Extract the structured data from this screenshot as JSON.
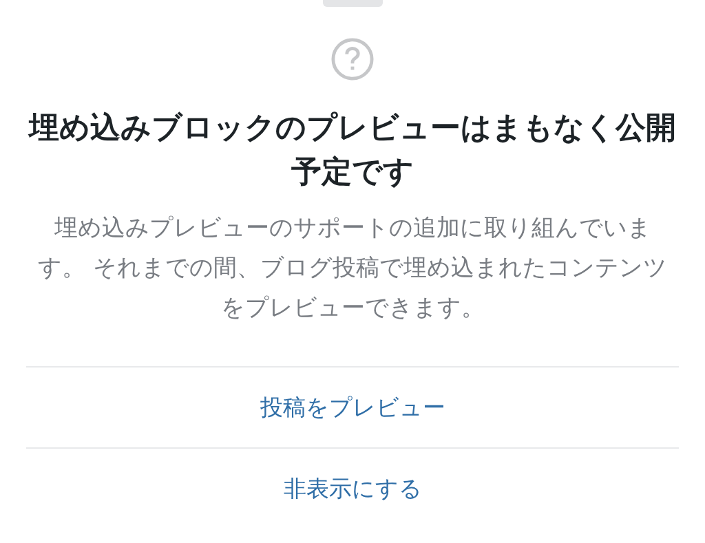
{
  "title": "埋め込みブロックのプレビューはまもなく公開予定です",
  "message": "埋め込みプレビューのサポートの追加に取り組んでいます。 それまでの間、ブログ投稿で埋め込まれたコンテンツをプレビューできます。",
  "actions": [
    {
      "label": "投稿をプレビュー"
    },
    {
      "label": "非表示にする"
    }
  ]
}
